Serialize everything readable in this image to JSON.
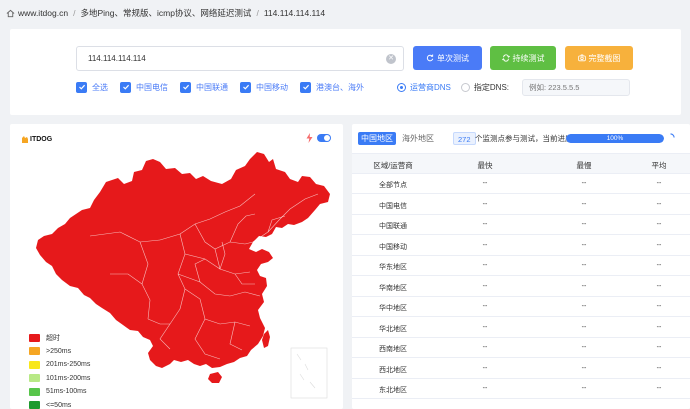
{
  "breadcrumb": [
    "www.itdog.cn",
    "多地Ping、常规版、icmp协议、网络延迟测试",
    "114.114.114.114"
  ],
  "search": {
    "value": "114.114.114.114"
  },
  "buttons": {
    "single": "单次测试",
    "continuous": "持续测试",
    "screenshot": "完整截图"
  },
  "checkboxes": [
    {
      "label": "全选",
      "checked": true
    },
    {
      "label": "中国电信",
      "checked": true
    },
    {
      "label": "中国联通",
      "checked": true
    },
    {
      "label": "中国移动",
      "checked": true
    },
    {
      "label": "港澳台、海外",
      "checked": true
    }
  ],
  "dns": {
    "operator_label": "运营商DNS",
    "custom_label": "指定DNS:",
    "placeholder": "例如: 223.5.5.5",
    "selected": "operator"
  },
  "map": {
    "logo": "ITDOG",
    "legend": [
      {
        "label": "超时",
        "color": "#e6191b"
      },
      {
        "label": ">250ms",
        "color": "#f5a623"
      },
      {
        "label": "201ms-250ms",
        "color": "#f8e71c"
      },
      {
        "label": "101ms-200ms",
        "color": "#b8e986"
      },
      {
        "label": "51ms-100ms",
        "color": "#57c54a"
      },
      {
        "label": "<=50ms",
        "color": "#1f9a2f"
      }
    ],
    "fill_color": "#e6191b"
  },
  "results": {
    "tabs": [
      "中国地区",
      "海外地区"
    ],
    "active_tab": 0,
    "node_count": "272",
    "count_suffix": "个监测点参与测试，当前进度:",
    "progress_fraction": 1.0,
    "progress_label": "100%",
    "columns": [
      "区域/运营商",
      "最快",
      "最慢",
      "平均"
    ],
    "rows": [
      {
        "region": "全部节点",
        "fast": "--",
        "slow": "--",
        "avg": "--"
      },
      {
        "region": "中国电信",
        "fast": "--",
        "slow": "--",
        "avg": "--"
      },
      {
        "region": "中国联通",
        "fast": "--",
        "slow": "--",
        "avg": "--"
      },
      {
        "region": "中国移动",
        "fast": "--",
        "slow": "--",
        "avg": "--"
      },
      {
        "region": "华东地区",
        "fast": "--",
        "slow": "--",
        "avg": "--"
      },
      {
        "region": "华南地区",
        "fast": "--",
        "slow": "--",
        "avg": "--"
      },
      {
        "region": "华中地区",
        "fast": "--",
        "slow": "--",
        "avg": "--"
      },
      {
        "region": "华北地区",
        "fast": "--",
        "slow": "--",
        "avg": "--"
      },
      {
        "region": "西南地区",
        "fast": "--",
        "slow": "--",
        "avg": "--"
      },
      {
        "region": "西北地区",
        "fast": "--",
        "slow": "--",
        "avg": "--"
      },
      {
        "region": "东北地区",
        "fast": "--",
        "slow": "--",
        "avg": "--"
      }
    ]
  }
}
